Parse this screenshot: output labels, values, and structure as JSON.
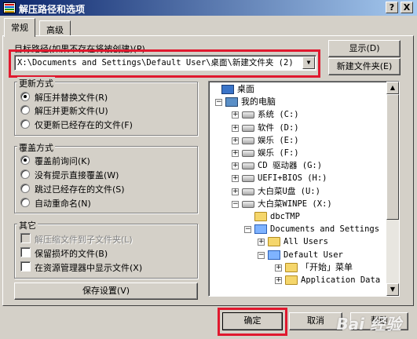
{
  "window": {
    "title": "解压路径和选项",
    "help_btn": "?",
    "close_btn": "X"
  },
  "tabs": [
    {
      "label": "常规",
      "active": true
    },
    {
      "label": "高级",
      "active": false
    }
  ],
  "path": {
    "label": "目标路径(如果不存在将被创建)(P)",
    "value": "X:\\Documents and Settings\\Default User\\桌面\\新建文件夹 (2)"
  },
  "buttons": {
    "show": "显示(D)",
    "new_folder": "新建文件夹(E)",
    "save_settings": "保存设置(V)",
    "ok": "确定",
    "cancel": "取消",
    "help": "帮助"
  },
  "update_mode": {
    "title": "更新方式",
    "options": [
      {
        "label": "解压并替换文件(R)",
        "checked": true
      },
      {
        "label": "解压并更新文件(U)",
        "checked": false
      },
      {
        "label": "仅更新已经存在的文件(F)",
        "checked": false
      }
    ]
  },
  "overwrite_mode": {
    "title": "覆盖方式",
    "options": [
      {
        "label": "覆盖前询问(K)",
        "checked": true
      },
      {
        "label": "没有提示直接覆盖(W)",
        "checked": false
      },
      {
        "label": "跳过已经存在的文件(S)",
        "checked": false
      },
      {
        "label": "自动重命名(N)",
        "checked": false
      }
    ]
  },
  "other": {
    "title": "其它",
    "options": [
      {
        "label": "解压缩文件到子文件夹(L)",
        "checked": false,
        "disabled": true
      },
      {
        "label": "保留损坏的文件(B)",
        "checked": false,
        "disabled": false
      },
      {
        "label": "在资源管理器中显示文件(X)",
        "checked": false,
        "disabled": false
      }
    ]
  },
  "tree": [
    {
      "label": "桌面",
      "indent": 0,
      "expander": "",
      "icon": "desktop-icon"
    },
    {
      "label": "我的电脑",
      "indent": 1,
      "expander": "−",
      "icon": "computer-icon"
    },
    {
      "label": "系统 (C:)",
      "indent": 2,
      "expander": "+",
      "icon": "drive-icon"
    },
    {
      "label": "软件 (D:)",
      "indent": 2,
      "expander": "+",
      "icon": "drive-icon"
    },
    {
      "label": "娱乐 (E:)",
      "indent": 2,
      "expander": "+",
      "icon": "drive-icon"
    },
    {
      "label": "娱乐 (F:)",
      "indent": 2,
      "expander": "+",
      "icon": "drive-icon"
    },
    {
      "label": "CD 驱动器 (G:)",
      "indent": 2,
      "expander": "+",
      "icon": "cd-drive-icon"
    },
    {
      "label": "UEFI+BIOS (H:)",
      "indent": 2,
      "expander": "+",
      "icon": "drive-icon"
    },
    {
      "label": "大白菜U盘 (U:)",
      "indent": 2,
      "expander": "+",
      "icon": "drive-icon"
    },
    {
      "label": "大白菜WINPE (X:)",
      "indent": 2,
      "expander": "−",
      "icon": "drive-icon"
    },
    {
      "label": "dbcTMP",
      "indent": 3,
      "expander": "",
      "icon": "folder-icon"
    },
    {
      "label": "Documents and Settings",
      "indent": 3,
      "expander": "−",
      "icon": "folder-open-icon"
    },
    {
      "label": "All Users",
      "indent": 4,
      "expander": "+",
      "icon": "folder-icon"
    },
    {
      "label": "Default User",
      "indent": 4,
      "expander": "−",
      "icon": "folder-open-icon"
    },
    {
      "label": "「开始」菜单",
      "indent": 5,
      "expander": "+",
      "icon": "folder-icon"
    },
    {
      "label": "Application Data",
      "indent": 5,
      "expander": "+",
      "icon": "folder-icon"
    }
  ],
  "watermark": "Bai 经验"
}
